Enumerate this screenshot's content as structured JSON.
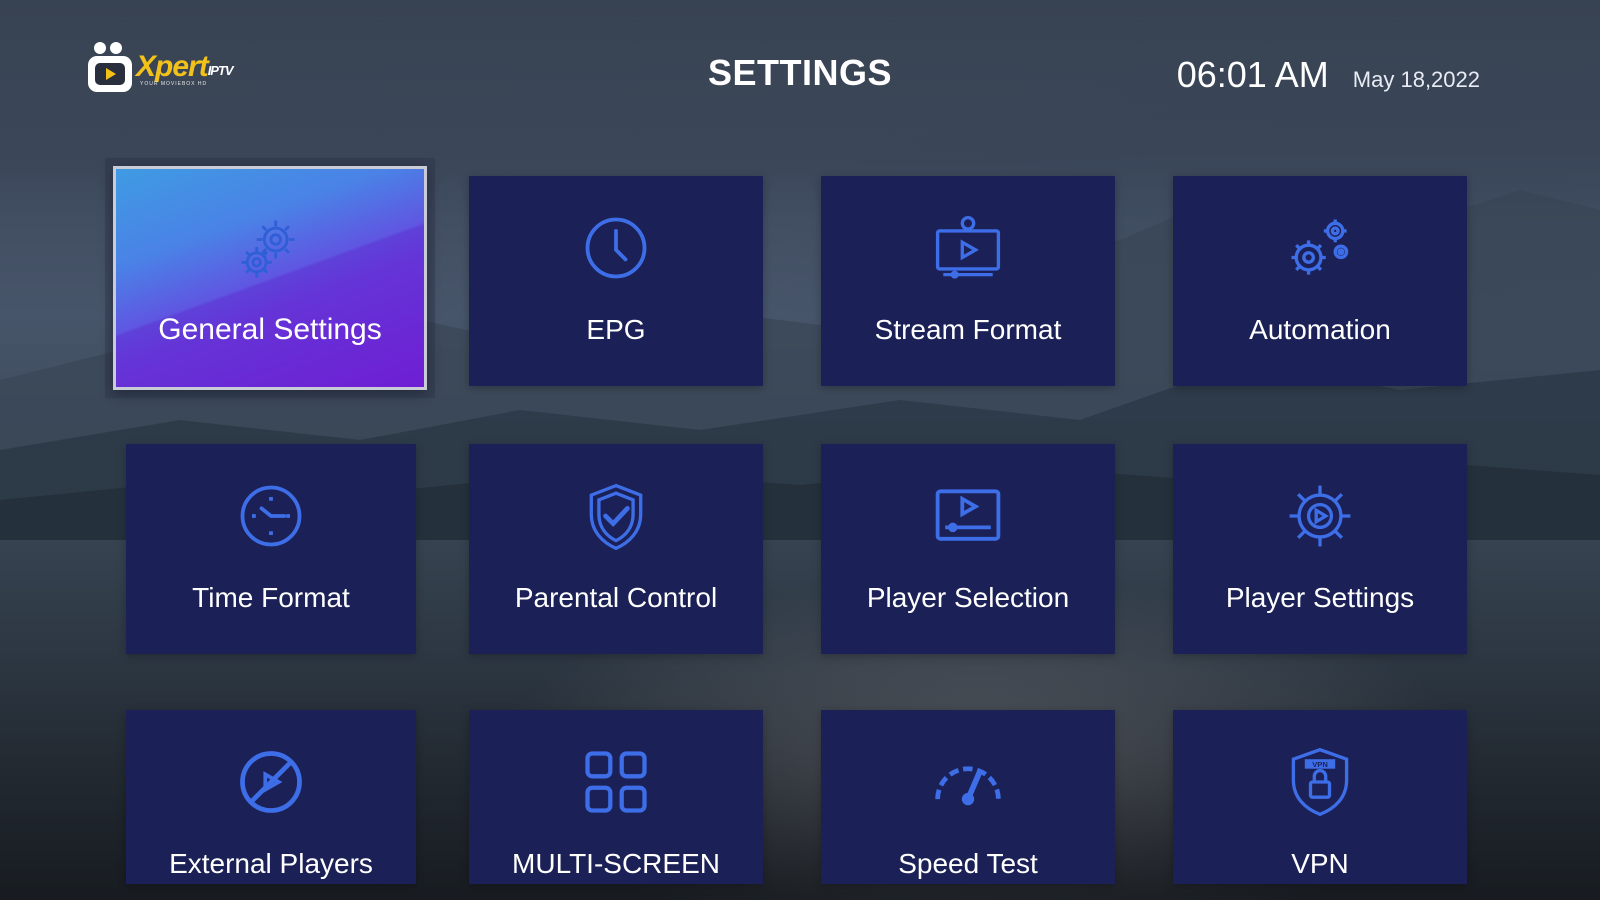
{
  "header": {
    "logo_text": "Xpert",
    "logo_sup": "IPTV",
    "logo_tagline": "YOUR MOVIEBOX HD",
    "title": "SETTINGS",
    "time": "06:01 AM",
    "date": "May 18,2022"
  },
  "tiles": [
    {
      "label": "General Settings",
      "icon": "gears-icon"
    },
    {
      "label": "EPG",
      "icon": "clock-icon"
    },
    {
      "label": "Stream Format",
      "icon": "stream-monitor-icon"
    },
    {
      "label": "Automation",
      "icon": "automation-gears-icon"
    },
    {
      "label": "Time Format",
      "icon": "time-clock-icon"
    },
    {
      "label": "Parental Control",
      "icon": "shield-check-icon"
    },
    {
      "label": "Player Selection",
      "icon": "player-screen-icon"
    },
    {
      "label": "Player Settings",
      "icon": "play-gear-icon"
    },
    {
      "label": "External Players",
      "icon": "external-player-icon"
    },
    {
      "label": "MULTI-SCREEN",
      "icon": "grid-icon"
    },
    {
      "label": "Speed Test",
      "icon": "speedometer-icon"
    },
    {
      "label": "VPN",
      "icon": "vpn-shield-icon"
    }
  ],
  "colors": {
    "tile_bg": "#1b2156",
    "icon_blue": "#3d6ee8",
    "logo_yellow": "#f3c21a",
    "active_from": "#3f9be3",
    "active_to": "#7a1ed9"
  }
}
